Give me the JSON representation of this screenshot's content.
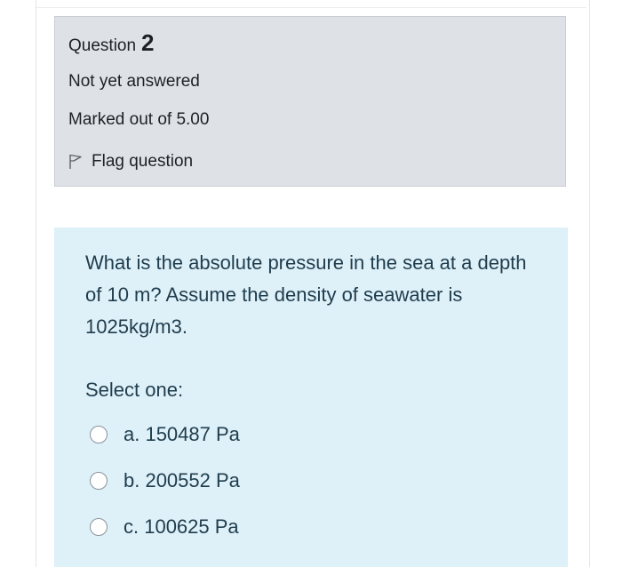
{
  "question_info": {
    "label": "Question",
    "number": "2",
    "status": "Not yet answered",
    "marks": "Marked out of 5.00",
    "flag_label": "Flag question",
    "flag_icon": "flag-icon"
  },
  "formulation": {
    "question_text": "What is the absolute pressure in the sea at a depth of 10 m? Assume the density of seawater is 1025kg/m3.",
    "prompt": "Select one:",
    "options": [
      {
        "label": "a. 150487 Pa",
        "selected": false
      },
      {
        "label": "b. 200552 Pa",
        "selected": false
      },
      {
        "label": "c. 100625 Pa",
        "selected": false
      }
    ]
  },
  "colors": {
    "info_background": "#dee2e6",
    "formulation_background": "#def0f8",
    "text": "#1d2125"
  }
}
